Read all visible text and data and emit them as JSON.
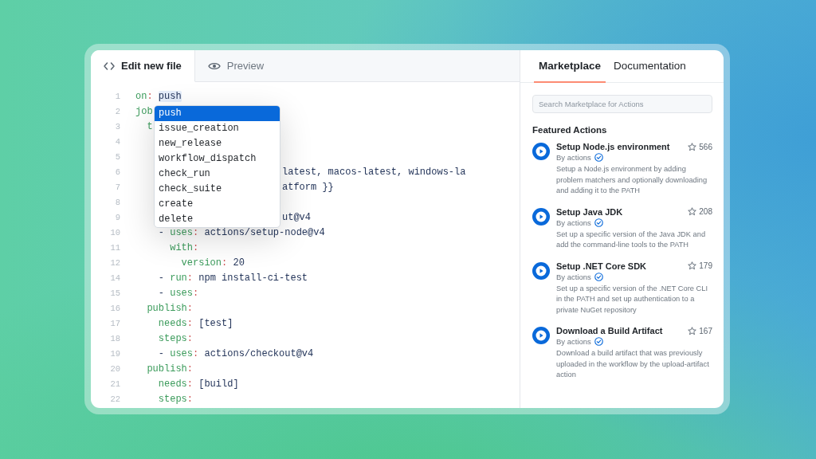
{
  "editor": {
    "tabs": [
      {
        "label": "Edit new file",
        "kind": "code",
        "selected": true
      },
      {
        "label": "Preview",
        "kind": "eye",
        "selected": false
      }
    ],
    "lines": [
      {
        "number": "1",
        "tokens": [
          {
            "kind": "key",
            "text": "on"
          },
          {
            "kind": "punct",
            "text": ": "
          },
          {
            "kind": "match",
            "text": "push"
          }
        ]
      },
      {
        "number": "2",
        "tokens": [
          {
            "kind": "key",
            "text": "job"
          }
        ]
      },
      {
        "number": "3",
        "tokens": [
          {
            "kind": "key",
            "text": "  t"
          }
        ]
      },
      {
        "number": "4"
      },
      {
        "number": "5"
      },
      {
        "number": "6",
        "kind": "after-menu",
        "tokens": [
          {
            "kind": "plain",
            "text": "latest, macos-latest, windows-la"
          }
        ]
      },
      {
        "number": "7",
        "kind": "after-menu",
        "tokens": [
          {
            "kind": "plain",
            "text": "atform }}"
          }
        ]
      },
      {
        "number": "8"
      },
      {
        "number": "9",
        "kind": "after-menu",
        "tokens": [
          {
            "kind": "plain",
            "text": "ut@v4"
          }
        ]
      },
      {
        "number": "10",
        "tokens": [
          {
            "kind": "plain",
            "text": "    - "
          },
          {
            "kind": "key",
            "text": "uses"
          },
          {
            "kind": "punct",
            "text": ": "
          },
          {
            "kind": "plain",
            "text": "actions/setup-node@v4"
          }
        ]
      },
      {
        "number": "11",
        "tokens": [
          {
            "kind": "key",
            "text": "      with"
          },
          {
            "kind": "punct",
            "text": ":"
          }
        ]
      },
      {
        "number": "12",
        "tokens": [
          {
            "kind": "key",
            "text": "        version"
          },
          {
            "kind": "punct",
            "text": ": "
          },
          {
            "kind": "plain",
            "text": "20"
          }
        ]
      },
      {
        "number": "14",
        "tokens": [
          {
            "kind": "plain",
            "text": "    - "
          },
          {
            "kind": "key",
            "text": "run"
          },
          {
            "kind": "punct",
            "text": ": "
          },
          {
            "kind": "plain",
            "text": "npm install-ci-test"
          }
        ]
      },
      {
        "number": "15",
        "tokens": [
          {
            "kind": "plain",
            "text": "    - "
          },
          {
            "kind": "key",
            "text": "uses"
          },
          {
            "kind": "punct",
            "text": ":"
          }
        ]
      },
      {
        "number": "16",
        "tokens": [
          {
            "kind": "key",
            "text": "  publish"
          },
          {
            "kind": "punct",
            "text": ":"
          }
        ]
      },
      {
        "number": "17",
        "tokens": [
          {
            "kind": "key",
            "text": "    needs"
          },
          {
            "kind": "punct",
            "text": ": "
          },
          {
            "kind": "plain",
            "text": "[test]"
          }
        ]
      },
      {
        "number": "18",
        "tokens": [
          {
            "kind": "key",
            "text": "    steps"
          },
          {
            "kind": "punct",
            "text": ":"
          }
        ]
      },
      {
        "number": "19",
        "tokens": [
          {
            "kind": "plain",
            "text": "    - "
          },
          {
            "kind": "key",
            "text": "uses"
          },
          {
            "kind": "punct",
            "text": ": "
          },
          {
            "kind": "plain",
            "text": "actions/checkout@v4"
          }
        ]
      },
      {
        "number": "20",
        "tokens": [
          {
            "kind": "key",
            "text": "  publish"
          },
          {
            "kind": "punct",
            "text": ":"
          }
        ]
      },
      {
        "number": "21",
        "tokens": [
          {
            "kind": "key",
            "text": "    needs"
          },
          {
            "kind": "punct",
            "text": ": "
          },
          {
            "kind": "plain",
            "text": "[build]"
          }
        ]
      },
      {
        "number": "22",
        "tokens": [
          {
            "kind": "key",
            "text": "    steps"
          },
          {
            "kind": "punct",
            "text": ":"
          }
        ]
      }
    ],
    "autocomplete": [
      {
        "label": "push",
        "selected": true
      },
      {
        "label": "issue_creation",
        "selected": false
      },
      {
        "label": "new_release",
        "selected": false
      },
      {
        "label": "workflow_dispatch",
        "selected": false
      },
      {
        "label": "check_run",
        "selected": false
      },
      {
        "label": "check_suite",
        "selected": false
      },
      {
        "label": "create",
        "selected": false
      },
      {
        "label": "delete",
        "selected": false
      }
    ]
  },
  "sidebar": {
    "tabs": [
      {
        "label": "Marketplace",
        "selected": true
      },
      {
        "label": "Documentation",
        "selected": false
      }
    ],
    "search": {
      "placeholder": "Search Marketplace for Actions"
    },
    "heading": "Featured Actions",
    "actions": [
      {
        "title": "Setup Node.js environment",
        "stars": "566",
        "author": "By actions",
        "verified": true,
        "description": "Setup a Node.js environment by adding problem matchers and optionally downloading and adding it to the PATH"
      },
      {
        "title": "Setup Java JDK",
        "stars": "208",
        "author": "By actions",
        "verified": true,
        "description": "Set up a specific version of the Java JDK and add the command-line tools to the PATH"
      },
      {
        "title": "Setup .NET Core SDK",
        "stars": "179",
        "author": "By actions",
        "verified": true,
        "description": "Set up a specific version of the .NET Core CLI in the PATH and set up authentication to a private NuGet repository"
      },
      {
        "title": "Download a Build Artifact",
        "stars": "167",
        "author": "By actions",
        "verified": true,
        "description": "Download a build artifact that was previously uploaded in the workflow by the upload-artifact action"
      }
    ]
  }
}
